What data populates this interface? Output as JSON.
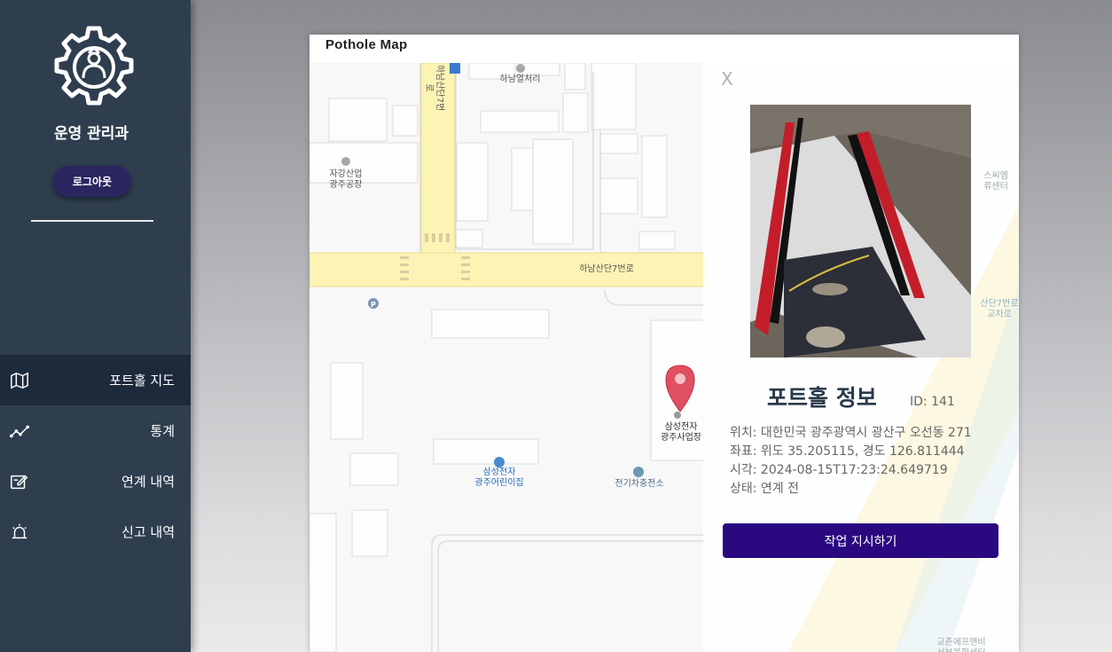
{
  "sidebar": {
    "dept_name": "운영 관리과",
    "logout_label": "로그아웃",
    "nav": [
      {
        "label": "포트홀 지도",
        "icon": "map-icon"
      },
      {
        "label": "통계",
        "icon": "chart-line-icon"
      },
      {
        "label": "연계 내역",
        "icon": "edit-icon"
      },
      {
        "label": "신고 내역",
        "icon": "alarm-icon"
      }
    ]
  },
  "main": {
    "title": "Pothole Map"
  },
  "map": {
    "labels": {
      "road_vertical": "하남산단7번로",
      "hanam_office": "하남열처리",
      "jagang": "자강산업\n광주공장",
      "road_horizontal": "하남산단7번로",
      "samsung_plant": "삼성전자\n광주사업장",
      "samsung_kids": "삼성전자\n광주어린이집",
      "ev_station": "전기차충전소",
      "right_top": "스씨엠\n류센터",
      "right_mid": "산단7번로\n교차로",
      "right_bottom": "교촌에프앤비\n서부복합센터",
      "parking": "P"
    }
  },
  "info_panel": {
    "close_label": "X",
    "title": "포트홀 정보",
    "id_text": "ID: 141",
    "location": "위치: 대한민국 광주광역시 광산구 오선동 271",
    "coords": "좌표: 위도 35.205115, 경도 126.811444",
    "time": "시각: 2024-08-15T17:23:24.649719",
    "status": "상태: 연계 전",
    "action_label": "작업 지시하기"
  },
  "colors": {
    "sidebar_bg": "#2e3e4f",
    "nav_active_bg": "#1d2a3c",
    "logout_bg": "#2b2560",
    "action_bg": "#2a0880",
    "road_yellow": "#fdf3b4",
    "marker_red": "#e05060"
  }
}
